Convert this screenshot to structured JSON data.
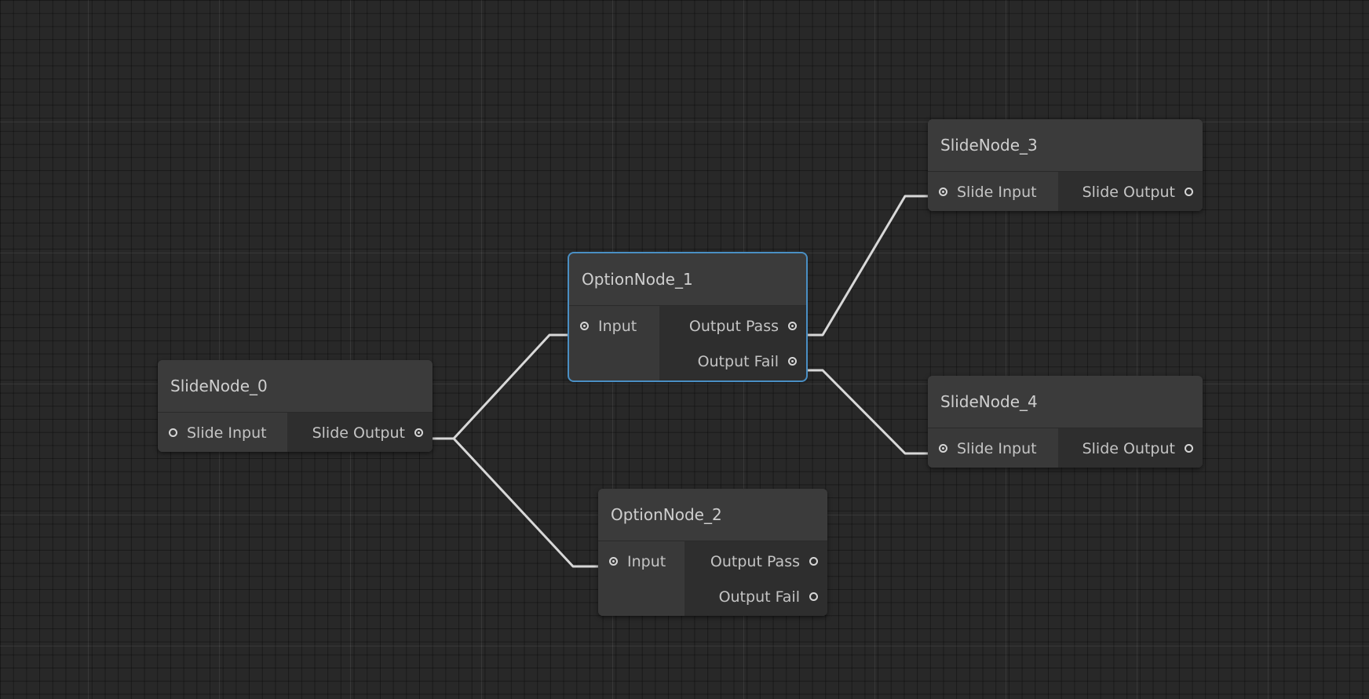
{
  "theme": {
    "background": "#282828",
    "node_body": "#3a3a3a",
    "selection_outline": "#4a8fc4",
    "edge_color": "#d8d8d8"
  },
  "nodes": {
    "slide_node_0": {
      "title": "SlideNode_0",
      "inputs": [
        {
          "label": "Slide Input",
          "connected": false
        }
      ],
      "outputs": [
        {
          "label": "Slide Output",
          "connected": true
        }
      ]
    },
    "option_node_1": {
      "title": "OptionNode_1",
      "selected": true,
      "inputs": [
        {
          "label": "Input",
          "connected": true
        }
      ],
      "outputs": [
        {
          "label": "Output Pass",
          "connected": true
        },
        {
          "label": "Output Fail",
          "connected": true
        }
      ]
    },
    "option_node_2": {
      "title": "OptionNode_2",
      "inputs": [
        {
          "label": "Input",
          "connected": true
        }
      ],
      "outputs": [
        {
          "label": "Output Pass",
          "connected": false
        },
        {
          "label": "Output Fail",
          "connected": false
        }
      ]
    },
    "slide_node_3": {
      "title": "SlideNode_3",
      "inputs": [
        {
          "label": "Slide Input",
          "connected": true
        }
      ],
      "outputs": [
        {
          "label": "Slide Output",
          "connected": false
        }
      ]
    },
    "slide_node_4": {
      "title": "SlideNode_4",
      "inputs": [
        {
          "label": "Slide Input",
          "connected": true
        }
      ],
      "outputs": [
        {
          "label": "Slide Output",
          "connected": false
        }
      ]
    }
  },
  "edges": [
    {
      "from": "SlideNode_0.Slide Output",
      "to": "OptionNode_1.Input"
    },
    {
      "from": "SlideNode_0.Slide Output",
      "to": "OptionNode_2.Input"
    },
    {
      "from": "OptionNode_1.Output Pass",
      "to": "SlideNode_3.Slide Input"
    },
    {
      "from": "OptionNode_1.Output Fail",
      "to": "SlideNode_4.Slide Input"
    }
  ]
}
